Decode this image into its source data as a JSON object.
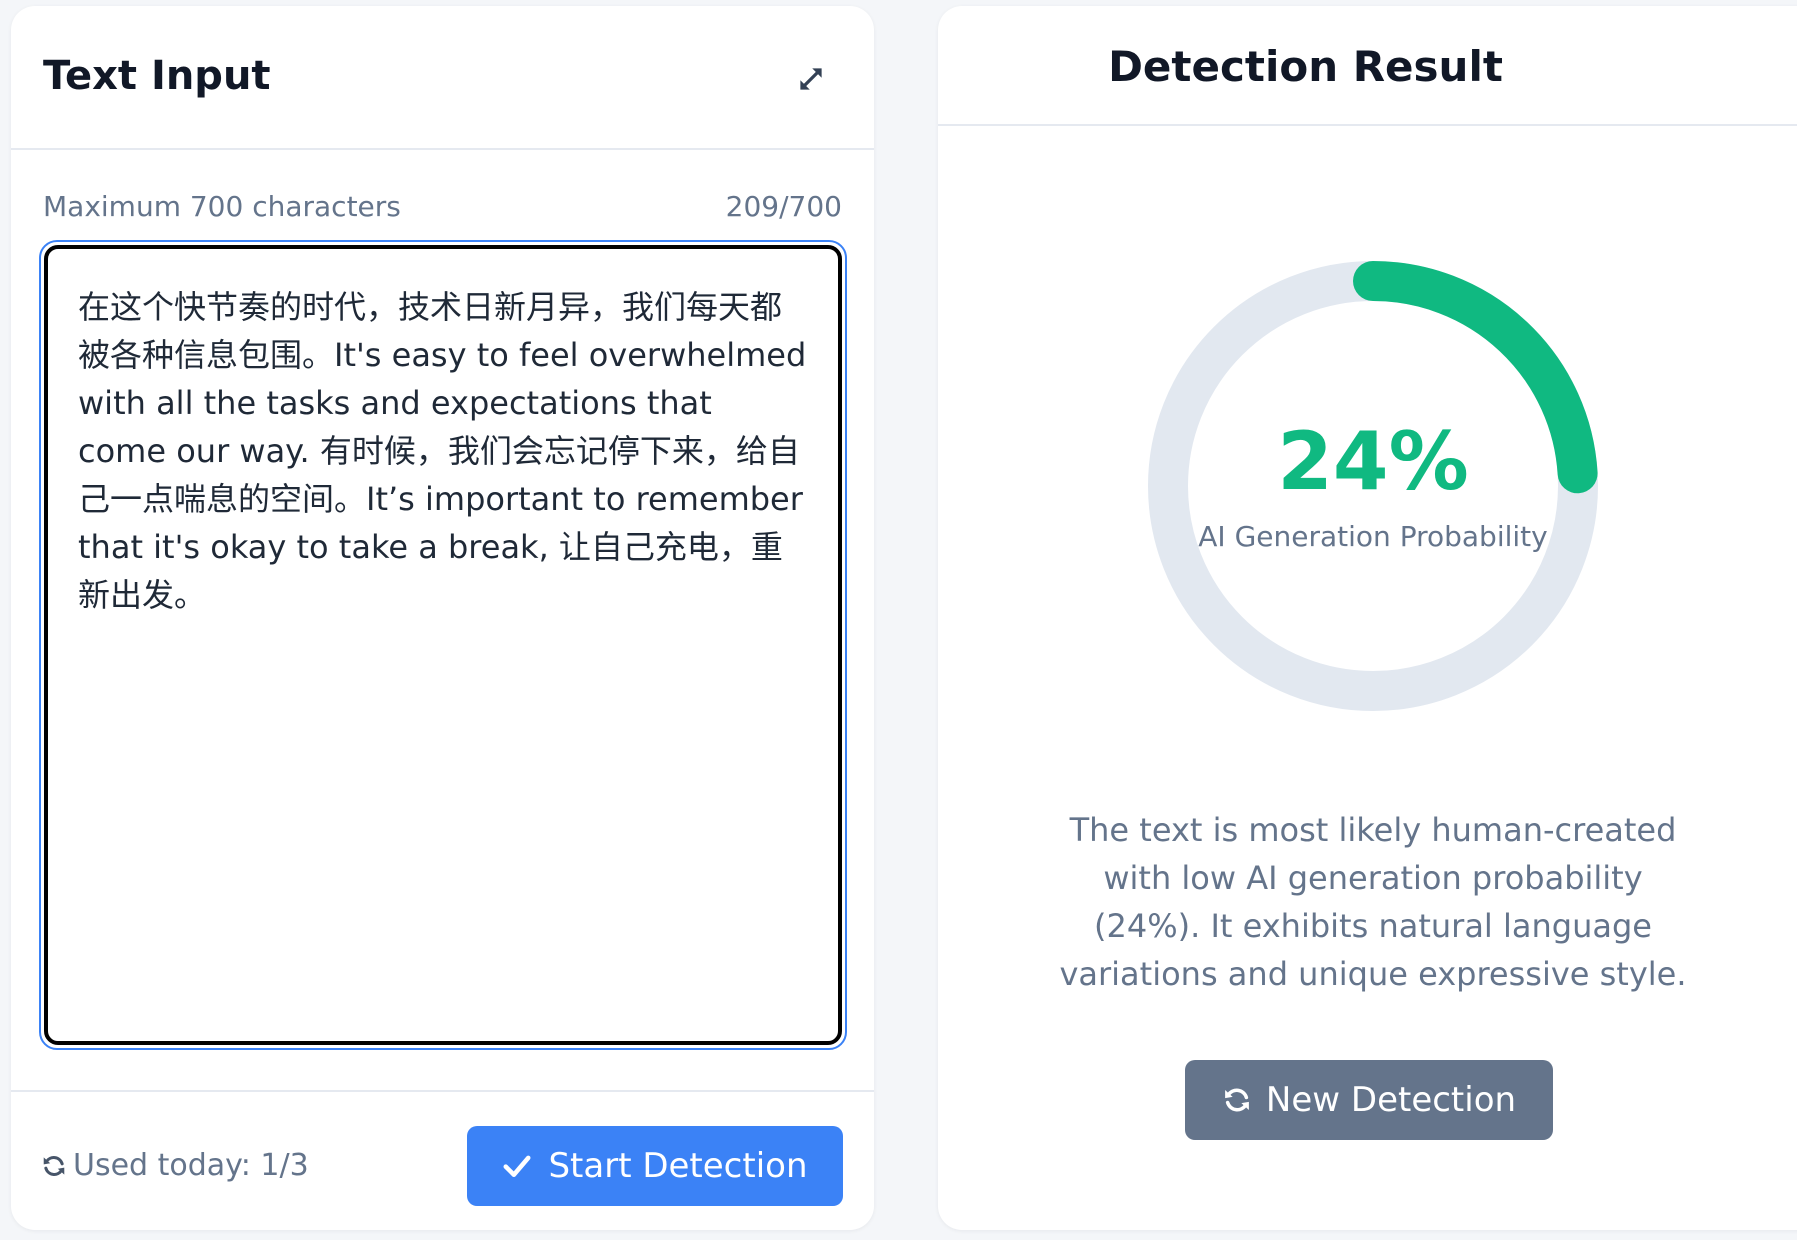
{
  "input_panel": {
    "title": "Text Input",
    "expand_icon": "expand-arrows-icon",
    "limit_label": "Maximum 700 characters",
    "char_count": "209/700",
    "text": "在这个快节奏的时代，技术日新月异，我们每天都被各种信息包围。It's easy to feel overwhelmed with all the tasks and expectations that come our way. 有时候，我们会忘记停下来，给自己一点喘息的空间。It’s important to remember that it's okay to take a break, 让自己充电，重新出发。",
    "usage_icon": "refresh-icon",
    "usage_label": "Used today: 1/3",
    "start_icon": "check-icon",
    "start_label": "Start Detection"
  },
  "result_panel": {
    "title": "Detection Result",
    "probability_percent": 24,
    "probability_label": "24%",
    "probability_caption": "AI Generation Probability",
    "description": "The text is most likely human-created with low AI generation probability (24%). It exhibits natural language variations and unique expressive style.",
    "new_icon": "refresh-icon",
    "new_label": "New Detection"
  },
  "colors": {
    "primary": "#3b82f6",
    "success": "#10b981",
    "track": "#e2e8f0",
    "secondary_button": "#64748b"
  }
}
